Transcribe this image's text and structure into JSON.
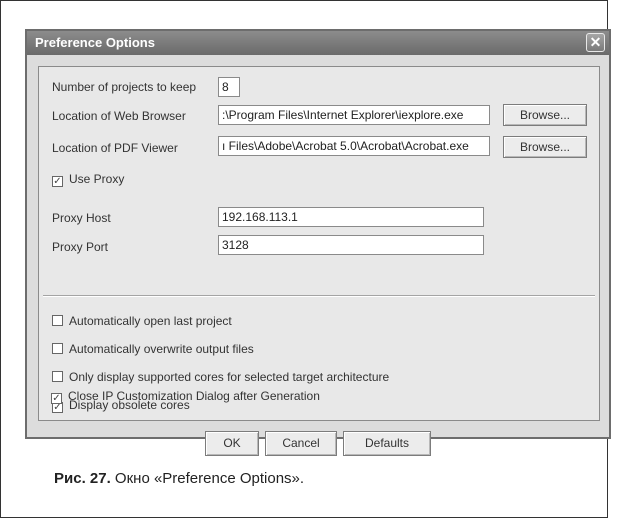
{
  "dialog": {
    "title": "Preference Options",
    "close_glyph": "✕"
  },
  "fields": {
    "projects_label": "Number of projects to keep",
    "projects_value": "8",
    "browser_label": "Location of Web Browser",
    "browser_value": ":\\Program Files\\Internet Explorer\\iexplore.exe",
    "pdf_label": "Location of PDF Viewer",
    "pdf_value": "ı Files\\Adobe\\Acrobat 5.0\\Acrobat\\Acrobat.exe",
    "browse_label": "Browse...",
    "use_proxy_label": "Use Proxy",
    "use_proxy_checked": true,
    "proxy_host_label": "Proxy Host",
    "proxy_host_value": "192.168.113.1",
    "proxy_port_label": "Proxy Port",
    "proxy_port_value": "3128"
  },
  "options": [
    {
      "label": "Automatically open last project",
      "checked": false
    },
    {
      "label": "Automatically overwrite output files",
      "checked": false
    },
    {
      "label": "Only display supported cores for selected target architecture",
      "checked": false
    },
    {
      "label": "Display obsolete cores",
      "checked": true
    },
    {
      "label": "Close IP Customization Dialog after Generation",
      "checked": true
    }
  ],
  "buttons": {
    "ok": "OK",
    "cancel": "Cancel",
    "defaults": "Defaults"
  },
  "caption": {
    "number": "Рис. 27.",
    "text": " Окно «Preference Options»."
  },
  "icons": {
    "check": "✓"
  }
}
